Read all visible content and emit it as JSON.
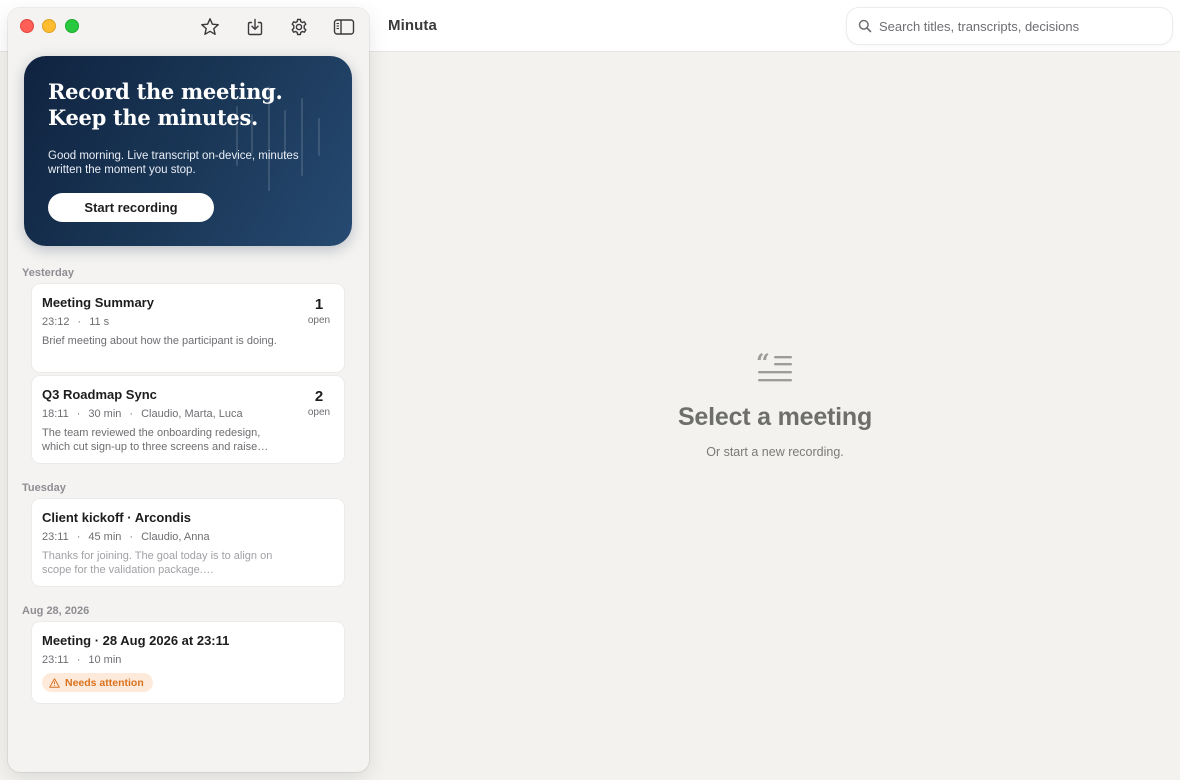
{
  "app": {
    "title": "Minuta"
  },
  "search": {
    "placeholder": "Search titles, transcripts, decisions"
  },
  "toolbar": {
    "icons": [
      "star-icon",
      "import-icon",
      "gear-icon",
      "sidebar-toggle-icon"
    ]
  },
  "hero": {
    "title_line1": "Record the meeting.",
    "title_line2": "Keep the minutes.",
    "subtitle": "Good morning. Live transcript on-device, minutes written the moment you stop.",
    "button_label": "Start recording"
  },
  "sections": [
    {
      "label": "Yesterday",
      "meetings": [
        {
          "title": "Meeting Summary",
          "time": "23:12",
          "duration": "11 s",
          "participants": "",
          "summary": "Brief meeting about how the participant is doing.",
          "open_count": "1",
          "open_label": "open"
        },
        {
          "title": "Q3 Roadmap Sync",
          "time": "18:11",
          "duration": "30 min",
          "participants": "Claudio, Marta, Luca",
          "summary": "The team reviewed the onboarding redesign, which cut sign-up to three screens and raise…",
          "open_count": "2",
          "open_label": "open"
        }
      ]
    },
    {
      "label": "Tuesday",
      "meetings": [
        {
          "title": "Client kickoff · Arcondis",
          "time": "23:11",
          "duration": "45 min",
          "participants": "Claudio, Anna",
          "summary": "Thanks for joining. The goal today is to align on scope for the validation package.…"
        }
      ]
    },
    {
      "label": "Aug 28, 2026",
      "meetings": [
        {
          "title": "Meeting · 28 Aug 2026 at 23:11",
          "time": "23:11",
          "duration": "10 min",
          "badge": "Needs attention"
        }
      ]
    }
  ],
  "meta_separator": "·",
  "empty_state": {
    "icon": "quote-lines-icon",
    "title": "Select a meeting",
    "subtitle": "Or start a new recording."
  },
  "colors": {
    "hero_gradient_start": "#0f2340",
    "hero_gradient_end": "#264a72",
    "badge_bg": "#fdeadb",
    "badge_text": "#d9731f",
    "traffic_red": "#ff5f57",
    "traffic_yellow": "#febc2e",
    "traffic_green": "#28c840"
  }
}
